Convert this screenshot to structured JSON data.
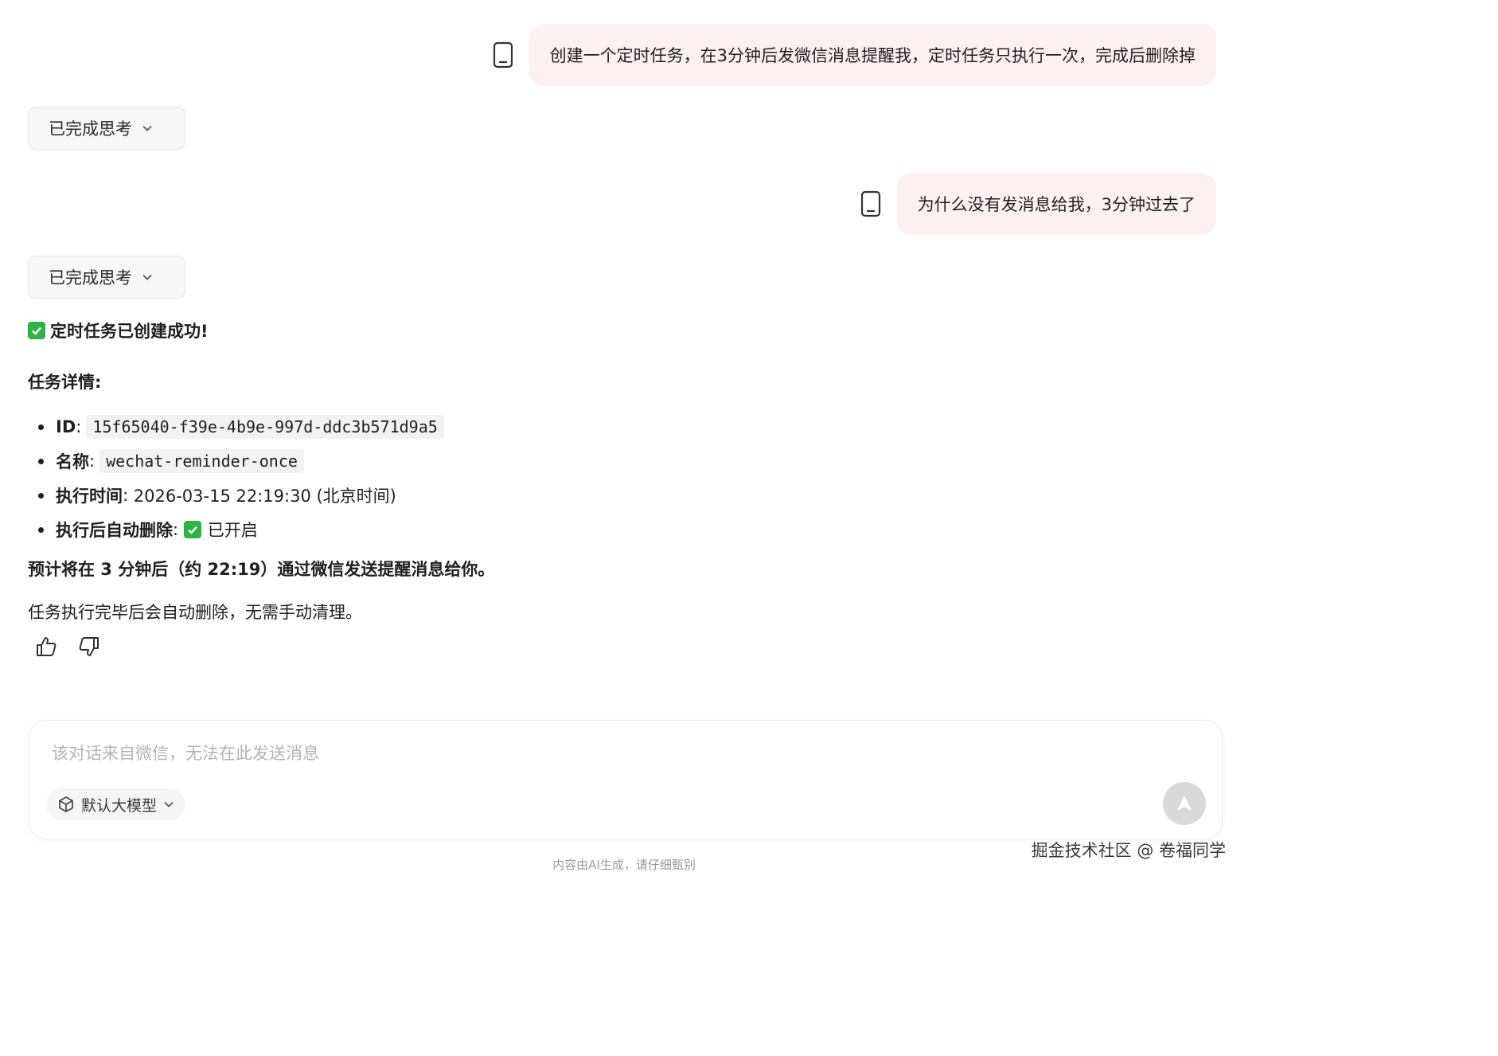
{
  "messages": [
    {
      "role": "user",
      "text": "创建一个定时任务，在3分钟后发微信消息提醒我，定时任务只执行一次，完成后删除掉"
    },
    {
      "role": "user",
      "text": "为什么没有发消息给我，3分钟过去了"
    }
  ],
  "thinking_label": "已完成思考",
  "answer": {
    "success": "定时任务已创建成功!",
    "details_heading": "任务详情:",
    "details": [
      {
        "label": "ID",
        "value": "15f65040-f39e-4b9e-997d-ddc3b571d9a5"
      },
      {
        "label": "名称",
        "value": "wechat-reminder-once"
      },
      {
        "label": "执行时间",
        "value": "2026-03-15 22:19:30 (北京时间)"
      },
      {
        "label": "执行后自动删除",
        "value": "已开启"
      }
    ],
    "eta": "预计将在 3 分钟后（约 22:19）通过微信发送提醒消息给你。",
    "note": "任务执行完毕后会自动删除，无需手动清理。"
  },
  "composer": {
    "placeholder": "该对话来自微信，无法在此发送消息",
    "model_label": "默认大模型"
  },
  "footer_note": "内容由AI生成，请仔细甄别",
  "watermark": "掘金技术社区 @ 卷福同学",
  "icons": {
    "device": "mobile-phone-icon",
    "chevron": "chevron-down-icon",
    "check": "check-box-icon",
    "like": "thumbs-up-icon",
    "dislike": "thumbs-down-icon",
    "model": "cube-icon",
    "send": "send-arrow-icon"
  },
  "colors": {
    "bubble": "#fdf0f0",
    "check": "#2fb344",
    "send_disabled": "#d9d9d9"
  }
}
